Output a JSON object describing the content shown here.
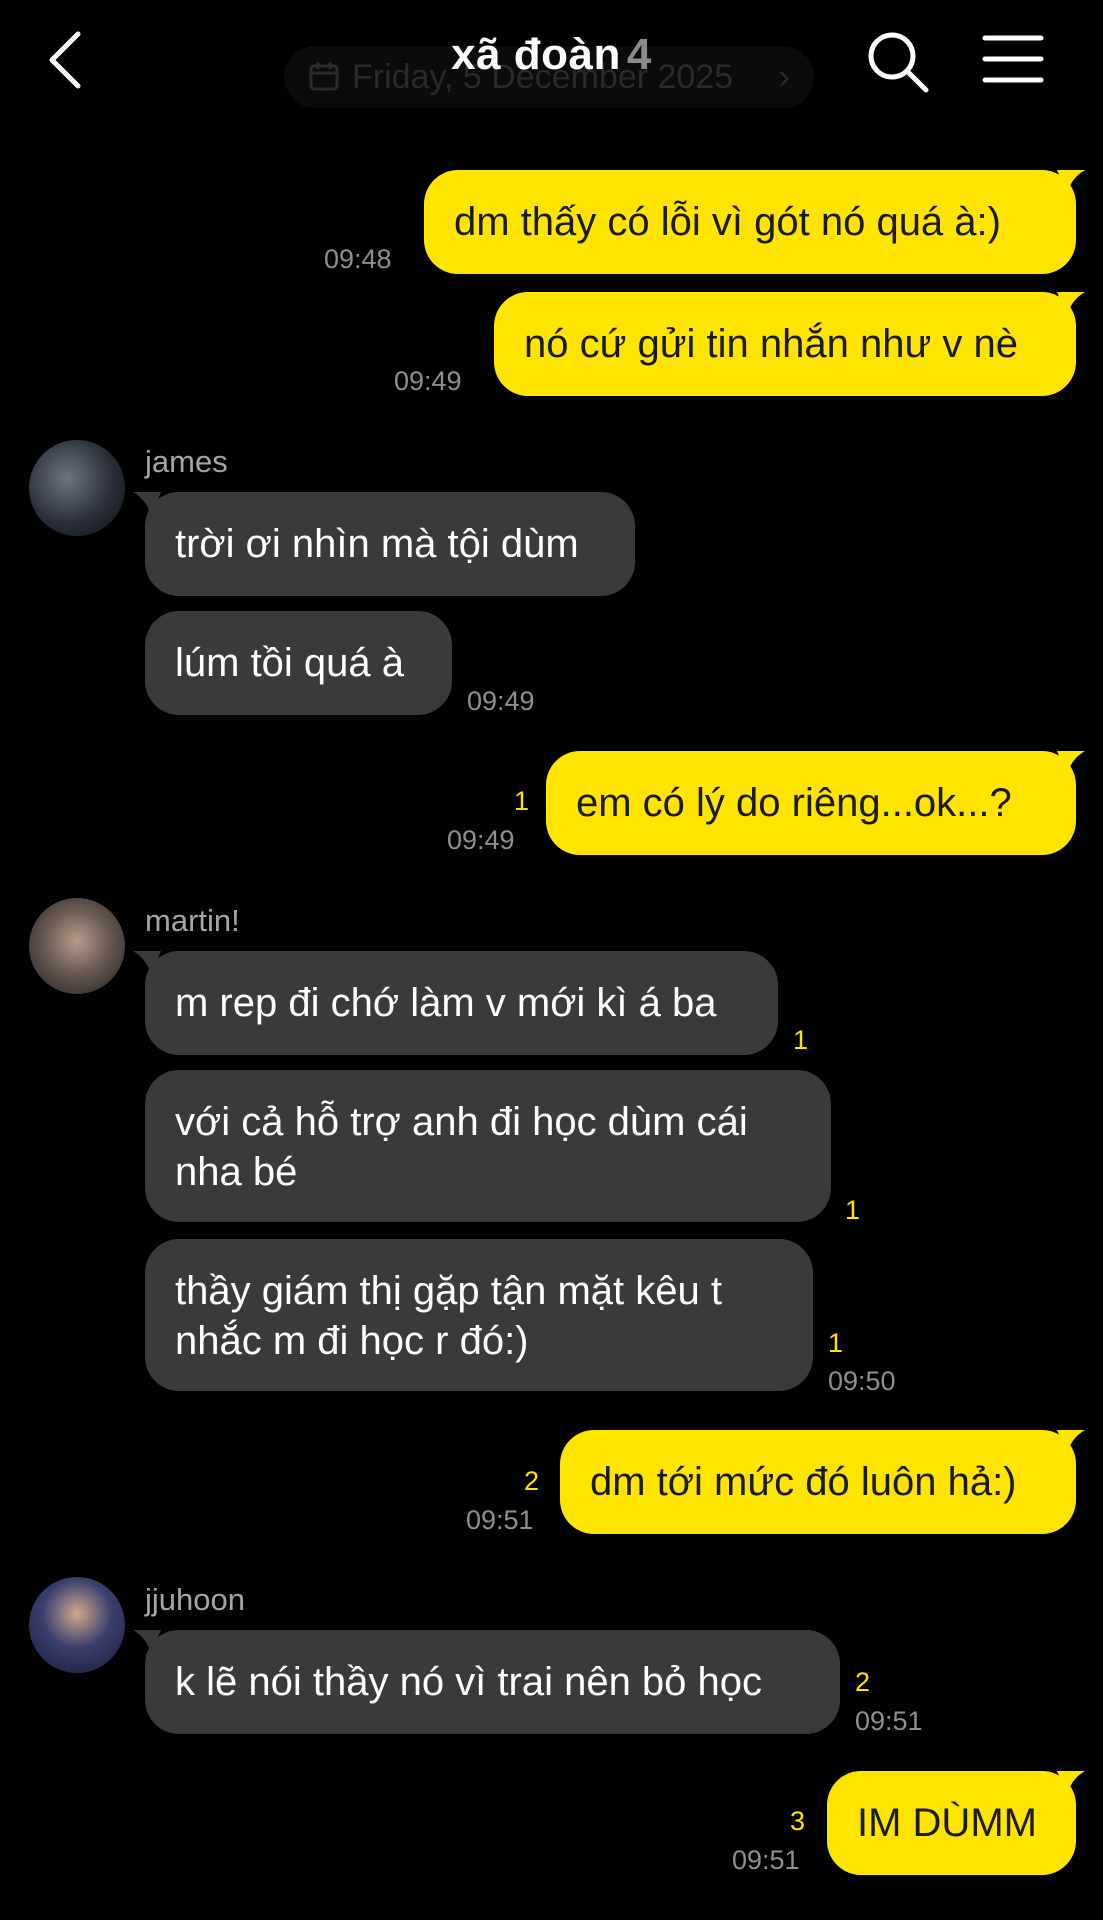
{
  "header": {
    "title": "xã đoàn",
    "member_count": "4",
    "date_pill": "Friday, 5 December 2025",
    "date_chevron": "›"
  },
  "messages": [
    {
      "text": "dm thấy có lỗi vì gót nó quá à:)",
      "time": "09:48"
    },
    {
      "text": "nó cứ gửi tin nhắn như v nè",
      "time": "09:49"
    },
    {
      "sender": "james"
    },
    {
      "text": "trời ơi nhìn mà tội dùm"
    },
    {
      "text": "lúm tồi quá à",
      "time": "09:49"
    },
    {
      "text": "em có lý do riêng...ok...?",
      "time": "09:49",
      "unread": "1"
    },
    {
      "sender": "martin!"
    },
    {
      "text": "m rep đi chớ làm v mới kì á ba",
      "unread": "1"
    },
    {
      "line1": "với cả hỗ trợ anh đi học dùm cái",
      "line2": "nha bé",
      "unread": "1"
    },
    {
      "line1": "thầy giám thị gặp tận mặt kêu t",
      "line2": "nhắc m đi học r đó:)",
      "time": "09:50",
      "unread": "1"
    },
    {
      "text": "dm tới mức đó luôn hả:)",
      "time": "09:51",
      "unread": "2"
    },
    {
      "sender": "jjuhoon"
    },
    {
      "text": "k lẽ nói thầy nó vì trai nên bỏ học",
      "time": "09:51",
      "unread": "2"
    },
    {
      "text": "IM DÙMM",
      "time": "09:51",
      "unread": "3"
    }
  ],
  "colors": {
    "my_bubble": "#fee500",
    "other_bubble": "#3a3a3c",
    "unread": "#fee500",
    "timestamp": "#8e8e93"
  },
  "icons": [
    "back-arrow-icon",
    "search-icon",
    "menu-icon",
    "calendar-icon"
  ]
}
